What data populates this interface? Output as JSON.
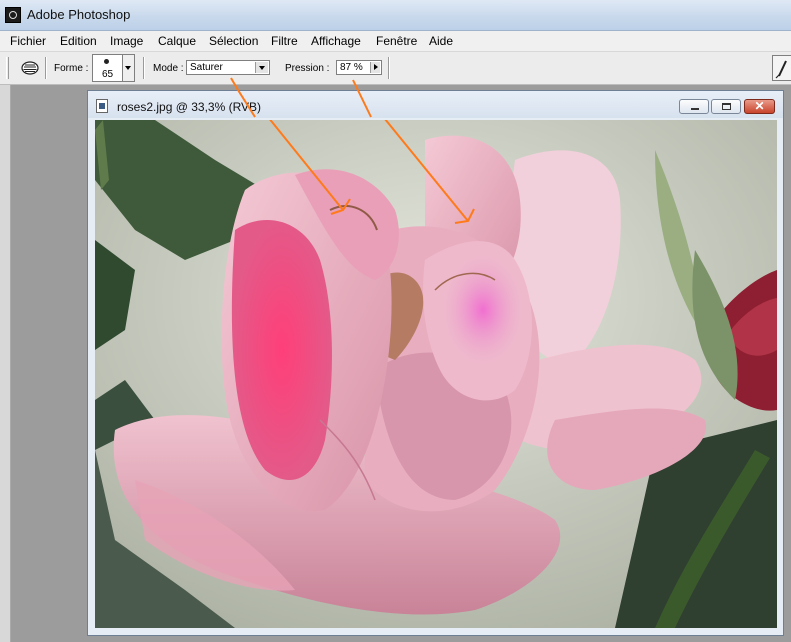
{
  "app": {
    "title": "Adobe Photoshop"
  },
  "menu": [
    "Fichier",
    "Edition",
    "Image",
    "Calque",
    "Sélection",
    "Filtre",
    "Affichage",
    "Fenêtre",
    "Aide"
  ],
  "options": {
    "tool_icon": "sponge-tool-icon",
    "forme_label": "Forme :",
    "brush_size": "65",
    "mode_label": "Mode :",
    "mode_value": "Saturer",
    "pression_label": "Pression :",
    "pression_value": "87 %"
  },
  "document": {
    "title": "roses2.jpg @ 33,3% (RVB)",
    "image_subject": "pink rose photo"
  },
  "colors": {
    "annotation_line": "#ff7a1a",
    "saturated_highlight": "#ff2e6e"
  }
}
